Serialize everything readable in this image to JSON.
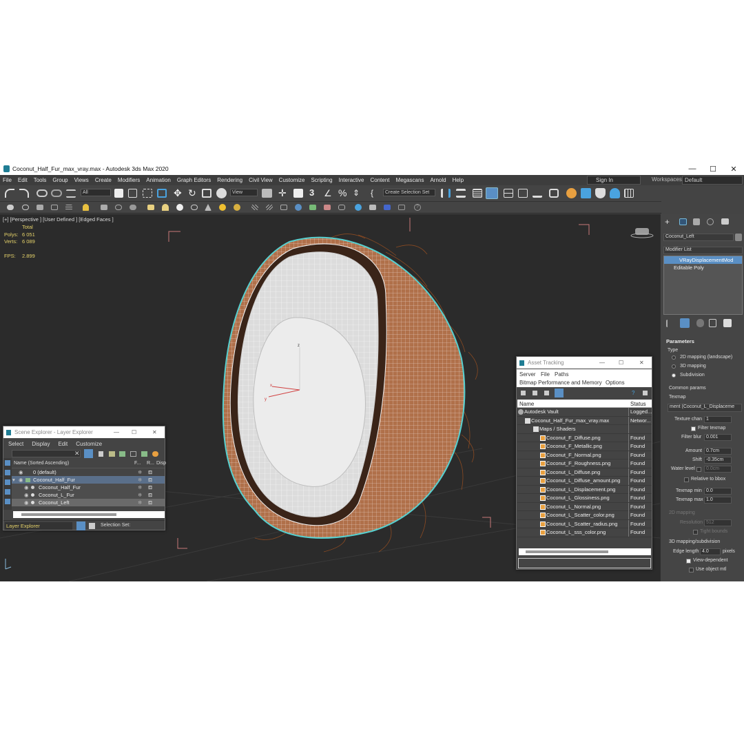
{
  "window": {
    "title": "Coconut_Half_Fur_max_vray.max - Autodesk 3ds Max 2020",
    "minimize": "—",
    "maximize": "☐",
    "close": "✕"
  },
  "menu": [
    "File",
    "Edit",
    "Tools",
    "Group",
    "Views",
    "Create",
    "Modifiers",
    "Animation",
    "Graph Editors",
    "Rendering",
    "Civil View",
    "Customize",
    "Scripting",
    "Interactive",
    "Content",
    "Megascans",
    "Arnold",
    "Help"
  ],
  "account": {
    "sign_in": "Sign In",
    "workspaces_label": "Workspaces:",
    "workspace": "Default"
  },
  "toolbar": {
    "filter": "All",
    "view": "View",
    "selection_set": "Create Selection Set"
  },
  "viewport": {
    "label": "[+] [Perspective ] [User Defined ] [Edged Faces ]",
    "stats": {
      "total": "Total",
      "polys_label": "Polys:",
      "polys": "6 051",
      "verts_label": "Verts:",
      "verts": "6 089",
      "fps_label": "FPS:",
      "fps": "2.899"
    }
  },
  "scene_explorer": {
    "title": "Scene Explorer - Layer Explorer",
    "menu": [
      "Select",
      "Display",
      "Edit",
      "Customize"
    ],
    "columns": {
      "name": "Name (Sorted Ascending)",
      "c2": "F...",
      "c3": "R...",
      "c4": "Disp"
    },
    "rows": [
      "0 (default)",
      "Coconut_Half_Fur",
      "Coconut_Half_Fur",
      "Coconut_L_Fur",
      "Coconut_Left"
    ],
    "footer_layer": "Layer Explorer",
    "footer_selset": "Selection Set:"
  },
  "asset_tracking": {
    "title": "Asset Tracking",
    "menu1": [
      "Server",
      "File",
      "Paths"
    ],
    "menu2": [
      "Bitmap Performance and Memory",
      "Options"
    ],
    "columns": {
      "name": "Name",
      "status": "Status"
    },
    "rows": [
      {
        "name": "Autodesk Vault",
        "status": "Logged..."
      },
      {
        "name": "Coconut_Half_Fur_max_vray.max",
        "status": "Networ..."
      },
      {
        "name": "Maps / Shaders",
        "status": ""
      },
      {
        "name": "Coconut_F_Diffuse.png",
        "status": "Found"
      },
      {
        "name": "Coconut_F_Metallic.png",
        "status": "Found"
      },
      {
        "name": "Coconut_F_Normal.png",
        "status": "Found"
      },
      {
        "name": "Coconut_F_Roughness.png",
        "status": "Found"
      },
      {
        "name": "Coconut_L_Diffuse.png",
        "status": "Found"
      },
      {
        "name": "Coconut_L_Diffuse_amount.png",
        "status": "Found"
      },
      {
        "name": "Coconut_L_Displacement.png",
        "status": "Found"
      },
      {
        "name": "Coconut_L_Glossiness.png",
        "status": "Found"
      },
      {
        "name": "Coconut_L_Normal.png",
        "status": "Found"
      },
      {
        "name": "Coconut_L_Scatter_color.png",
        "status": "Found"
      },
      {
        "name": "Coconut_L_Scatter_radius.png",
        "status": "Found"
      },
      {
        "name": "Coconut_L_sss_color.png",
        "status": "Found"
      }
    ]
  },
  "command_panel": {
    "object_name": "Coconut_Left",
    "modifier_list": "Modifier List",
    "stack": [
      "VRayDisplacementMod",
      "Editable Poly"
    ],
    "parameters": "Parameters",
    "type_label": "Type",
    "types": [
      "2D mapping (landscape)",
      "3D mapping",
      "Subdivision"
    ],
    "common_params": "Common params",
    "texmap": "Texmap",
    "texmap_value": "ment (Coconut_L_Displaceme",
    "texture_chan_label": "Texture chan",
    "texture_chan": "1",
    "filter_texmap": "Filter texmap",
    "filter_blur_label": "Filter blur",
    "filter_blur": "0.001",
    "amount_label": "Amount",
    "amount": "0.7cm",
    "shift_label": "Shift",
    "shift": "-0.35cm",
    "water_level_label": "Water level",
    "water_level": "0.0cm",
    "relative_to_bbox": "Relative to bbox",
    "texmap_min_label": "Texmap min",
    "texmap_min": "0.0",
    "texmap_max_label": "Texmap max",
    "texmap_max": "1.0",
    "mapping2d": "2D mapping",
    "resolution_label": "Resolution",
    "resolution": "512",
    "tight_bounds": "Tight bounds",
    "mapping3d": "3D mapping/subdivision",
    "edge_length_label": "Edge length",
    "edge_length": "4.0",
    "pixels": "pixels",
    "view_dependent": "View-dependent",
    "use_object_mtl": "Use object mtl"
  }
}
